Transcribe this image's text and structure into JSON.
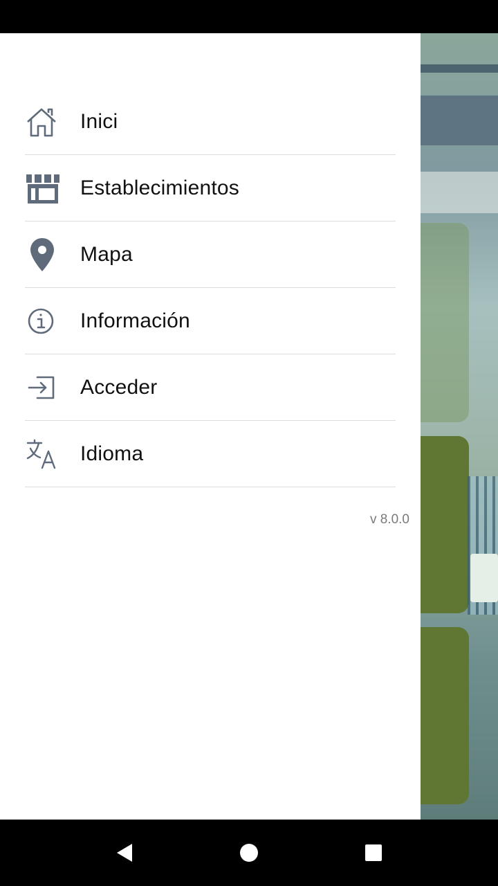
{
  "drawer": {
    "items": [
      {
        "label": "Inici",
        "icon": "home-icon"
      },
      {
        "label": "Establecimientos",
        "icon": "store-icon"
      },
      {
        "label": "Mapa",
        "icon": "map-pin-icon"
      },
      {
        "label": "Información",
        "icon": "info-icon"
      },
      {
        "label": "Acceder",
        "icon": "login-icon"
      },
      {
        "label": "Idioma",
        "icon": "translate-icon"
      }
    ],
    "version": "v 8.0.0"
  },
  "colors": {
    "icon": "#5f6b7a",
    "card_green": "#5f7732",
    "divider": "#dcdcdc"
  }
}
